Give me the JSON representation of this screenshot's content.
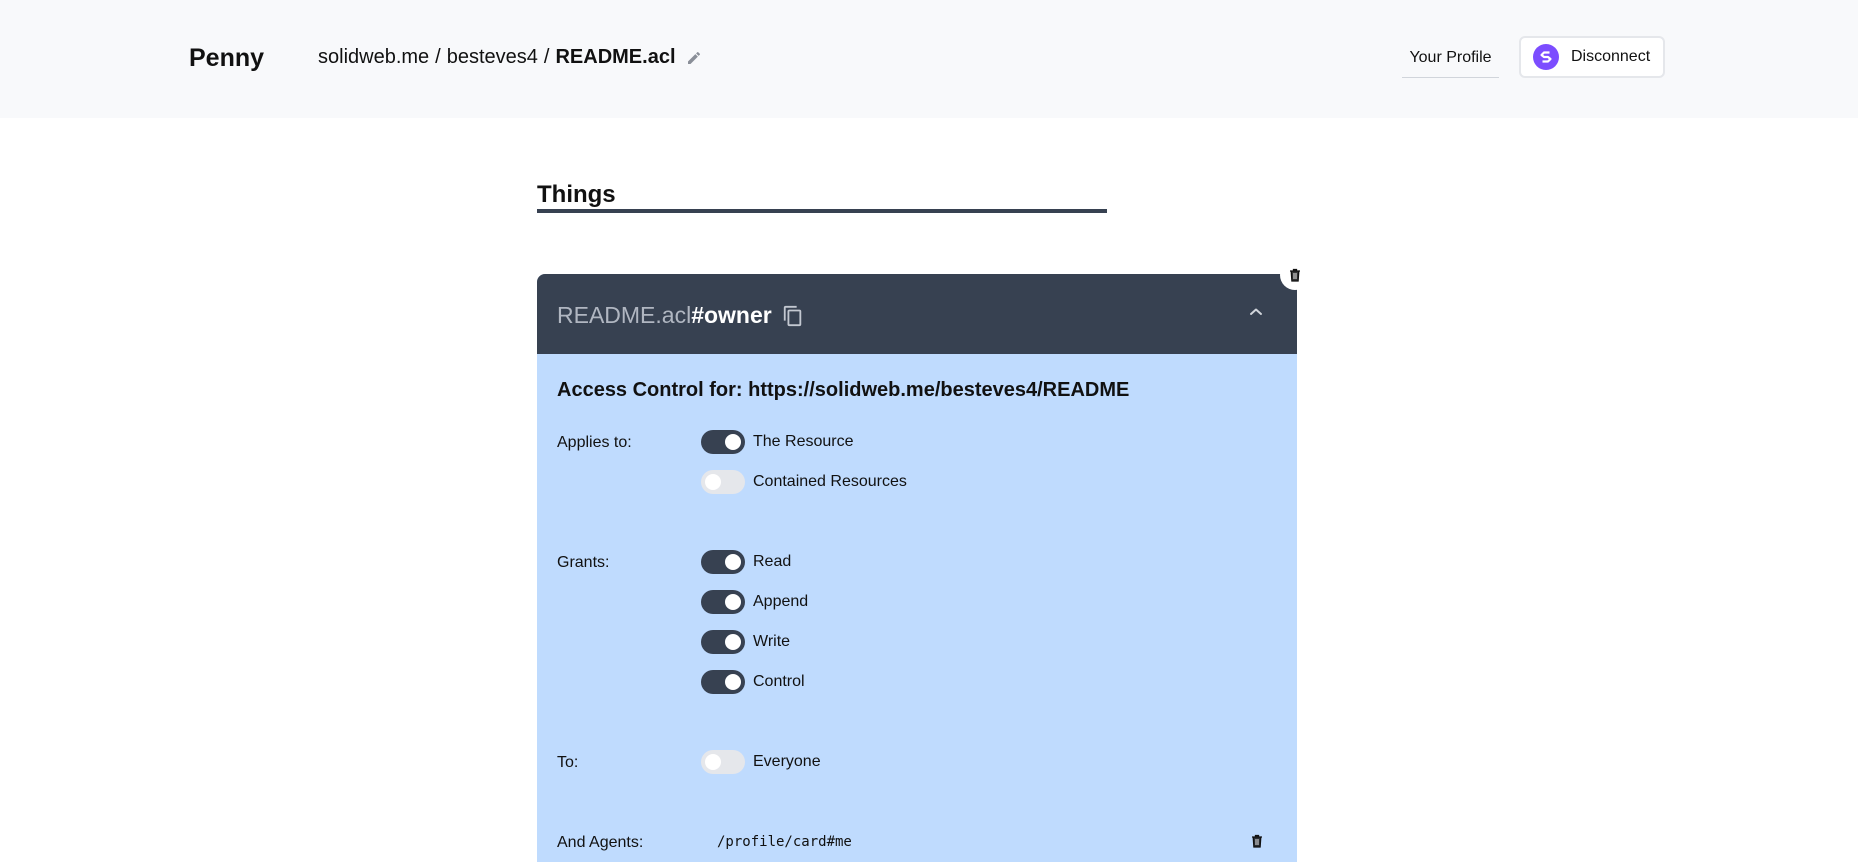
{
  "header": {
    "brand": "Penny",
    "breadcrumb": {
      "host": "solidweb.me",
      "separator": "/",
      "folder": "besteves4",
      "current": "README.acl",
      "edit_icon": "pencil-icon"
    },
    "profile_link": "Your Profile",
    "disconnect_label": "Disconnect",
    "disconnect_icon": "inrupt-logo-icon"
  },
  "section": {
    "title": "Things"
  },
  "thing_card": {
    "title_base": "README.acl",
    "title_fragment": "#owner",
    "copy_icon": "copy-icon",
    "collapse_icon": "chevron-up-icon",
    "delete_icon": "trash-icon",
    "access_heading": "Access Control for: https://solidweb.me/besteves4/README",
    "applies_to": {
      "label": "Applies to:",
      "options": [
        {
          "label": "The Resource",
          "enabled": true
        },
        {
          "label": "Contained Resources",
          "enabled": false
        }
      ]
    },
    "grants": {
      "label": "Grants:",
      "options": [
        {
          "label": "Read",
          "enabled": true
        },
        {
          "label": "Append",
          "enabled": true
        },
        {
          "label": "Write",
          "enabled": true
        },
        {
          "label": "Control",
          "enabled": true
        }
      ]
    },
    "to": {
      "label": "To:",
      "options": [
        {
          "label": "Everyone",
          "enabled": false
        }
      ]
    },
    "agents": {
      "label": "And Agents:",
      "values": [
        "/profile/card#me"
      ],
      "delete_icon": "trash-icon"
    }
  },
  "colors": {
    "header_bg": "#f8f9fb",
    "card_header_bg": "#374151",
    "card_body_bg": "#bfdbfe",
    "toggle_on": "#374151",
    "toggle_off": "#e5e7eb",
    "brand_accent": "#7c4dff"
  }
}
